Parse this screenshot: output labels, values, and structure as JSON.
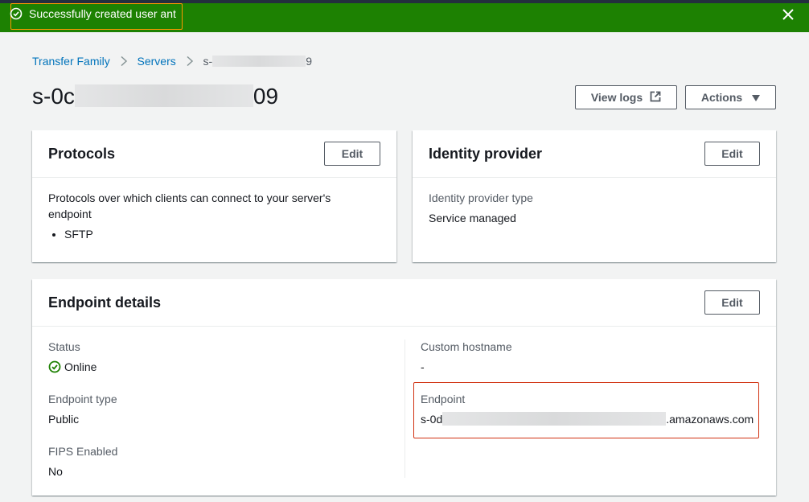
{
  "flash": {
    "message": "Successfully created user ant",
    "icon": "check-circle-icon",
    "close_icon": "close-icon",
    "color": "#1d8102"
  },
  "breadcrumb": {
    "items": [
      {
        "label": "Transfer Family"
      },
      {
        "label": "Servers"
      }
    ],
    "current_prefix": "s-",
    "current_suffix": "9"
  },
  "page": {
    "title_prefix": "s-0c",
    "title_suffix": "09"
  },
  "header_buttons": {
    "view_logs": "View logs",
    "actions": "Actions"
  },
  "protocols_card": {
    "title": "Protocols",
    "edit": "Edit",
    "description": "Protocols over which clients can connect to your server's endpoint",
    "items": [
      "SFTP"
    ]
  },
  "identity_card": {
    "title": "Identity provider",
    "edit": "Edit",
    "type_label": "Identity provider type",
    "type_value": "Service managed"
  },
  "endpoint_card": {
    "title": "Endpoint details",
    "edit": "Edit",
    "status_label": "Status",
    "status_value": "Online",
    "endpoint_type_label": "Endpoint type",
    "endpoint_type_value": "Public",
    "fips_label": "FIPS Enabled",
    "fips_value": "No",
    "custom_hostname_label": "Custom hostname",
    "custom_hostname_value": "-",
    "endpoint_label": "Endpoint",
    "endpoint_prefix": "s-0d",
    "endpoint_suffix": ".amazonaws.com"
  },
  "colors": {
    "link": "#0073bb",
    "success": "#1d8102",
    "highlight_orange": "#ff9900",
    "highlight_red": "#d13212"
  }
}
